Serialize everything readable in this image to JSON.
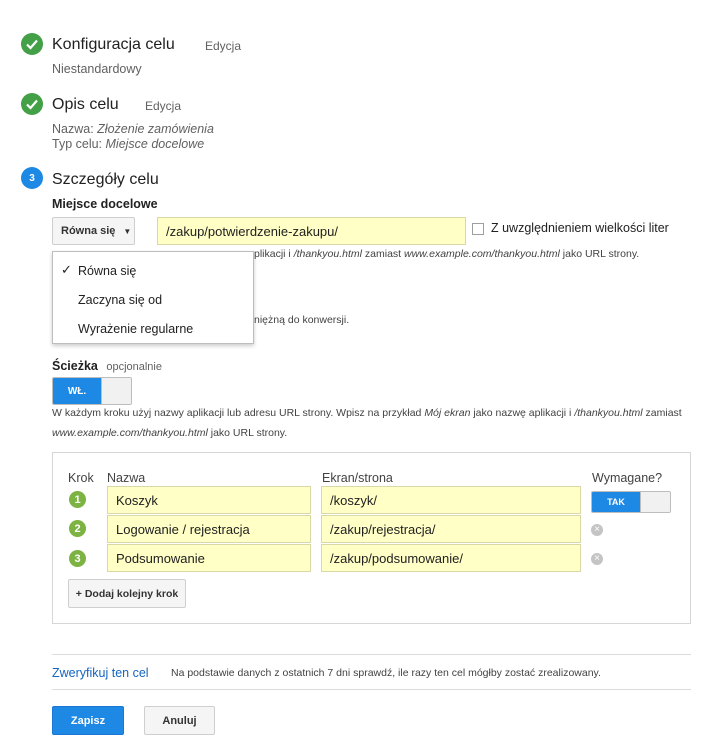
{
  "steps": [
    {
      "number": "",
      "title": "Konfiguracja celu",
      "edit": "Edycja",
      "lines": [
        "Niestandardowy"
      ]
    },
    {
      "number": "",
      "title": "Opis celu",
      "edit": "Edycja",
      "name_label": "Nazwa:",
      "name_value": "Złożenie zamówienia",
      "type_label": "Typ celu:",
      "type_value": "Miejsce docelowe"
    },
    {
      "number": "3",
      "title": "Szczegóły celu"
    }
  ],
  "destination": {
    "label": "Miejsce docelowe",
    "match_type": "Równa się",
    "value": "/zakup/potwierdzenie-zakupu/",
    "case_sensitive_label": "Z uwzględnieniem wielkości liter",
    "hint_part1": "plikacji i",
    "hint_italic1": "/thankyou.html",
    "hint_part2": "zamiast",
    "hint_italic2": "www.example.com/thankyou.html",
    "hint_part3": "jako URL strony.",
    "hidden_fragment": "niężną do konwersji."
  },
  "match_dropdown": {
    "options": [
      "Równa się",
      "Zaczyna się od",
      "Wyrażenie regularne"
    ],
    "selected_index": 0
  },
  "path": {
    "label": "Ścieżka",
    "optional": "opcjonalnie",
    "toggle_label": "WŁ.",
    "hint_a": "W każdym kroku użyj nazwy aplikacji lub adresu URL strony. Wpisz na przykład",
    "hint_italic_a": "Mój ekran",
    "hint_b": "jako nazwę aplikacji i",
    "hint_italic_b": "/thankyou.html",
    "hint_c": "zamiast",
    "hint_italic_c": "www.example.com/thankyou.html",
    "hint_d": "jako URL strony."
  },
  "funnel": {
    "headers": {
      "step": "Krok",
      "name": "Nazwa",
      "screen": "Ekran/strona",
      "required": "Wymagane?"
    },
    "rows": [
      {
        "num": "1",
        "name": "Koszyk",
        "screen": "/koszyk/"
      },
      {
        "num": "2",
        "name": "Logowanie / rejestracja",
        "screen": "/zakup/rejestracja/"
      },
      {
        "num": "3",
        "name": "Podsumowanie",
        "screen": "/zakup/podsumowanie/"
      }
    ],
    "required_toggle": "TAK",
    "add_step": "+ Dodaj kolejny krok"
  },
  "verify": {
    "link": "Zweryfikuj ten cel",
    "text": "Na podstawie danych z ostatnich 7 dni sprawdź, ile razy ten cel mógłby zostać zrealizowany."
  },
  "buttons": {
    "save": "Zapisz",
    "cancel": "Anuluj"
  },
  "colors": {
    "accent": "#1e88e5",
    "success": "#43a047",
    "step_badge": "#7cb342",
    "input_bg": "#ffffc6"
  }
}
